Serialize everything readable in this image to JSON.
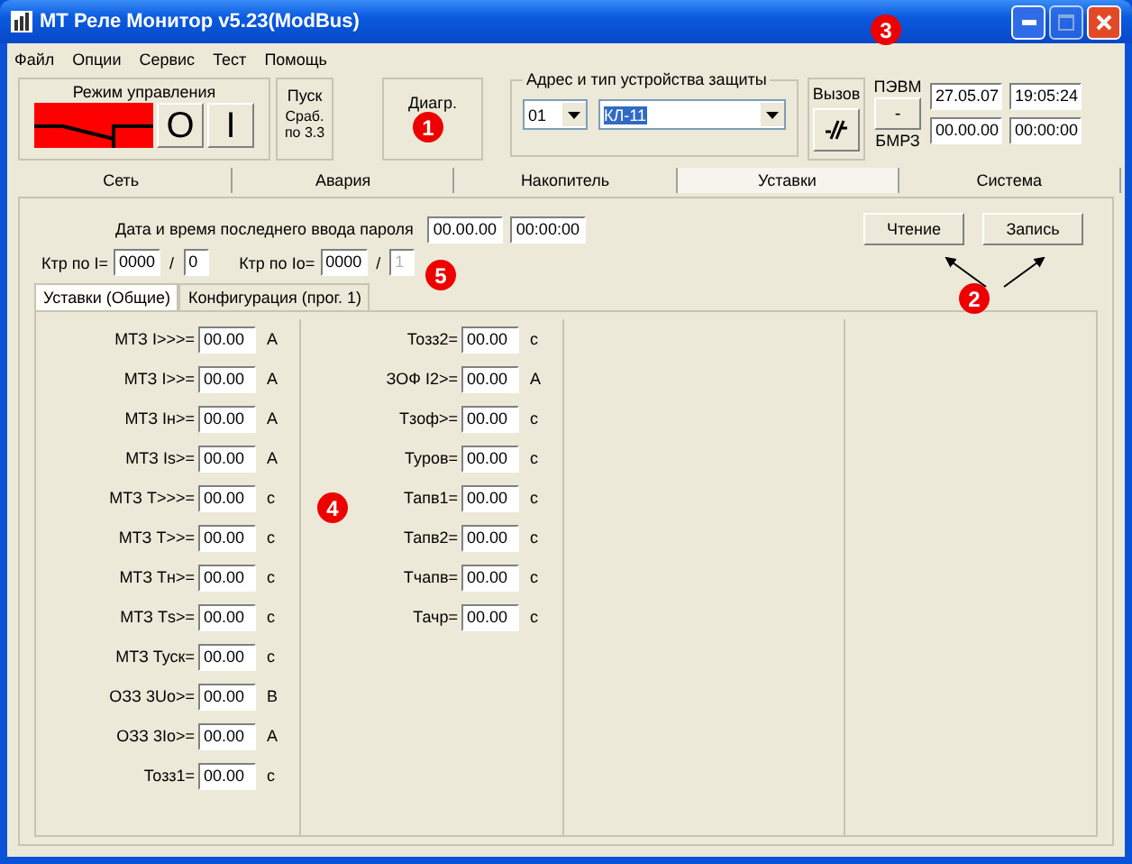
{
  "window": {
    "title": "МТ Реле Монитор v5.23(ModBus)"
  },
  "menu": [
    "Файл",
    "Опции",
    "Сервис",
    "Тест",
    "Помощь"
  ],
  "control_mode": {
    "label": "Режим управления",
    "buttons": [
      "O",
      "I"
    ]
  },
  "start": {
    "label": "Пуск",
    "status": "Сраб. по 3.3"
  },
  "diagram": {
    "label": "Диагр."
  },
  "device": {
    "label": "Адрес и тип устройства защиты",
    "address": "01",
    "type": "КЛ-11",
    "type_selected": true
  },
  "call": {
    "label": "Вызов"
  },
  "link": {
    "top": "ПЭВМ",
    "button": "-",
    "bottom": "БМРЗ"
  },
  "clock": [
    "27.05.07",
    "19:05:24",
    "00.00.00",
    "00:00:00"
  ],
  "tabs": [
    {
      "label": "Сеть",
      "selected": false
    },
    {
      "label": "Авария",
      "selected": false
    },
    {
      "label": "Накопитель",
      "selected": false
    },
    {
      "label": "Уставки",
      "selected": true
    },
    {
      "label": "Система",
      "selected": false
    }
  ],
  "password": {
    "label": "Дата и время последнего ввода пароля",
    "date": "00.00.00",
    "time": "00:00:00"
  },
  "actions": [
    "Чтение",
    "Запись"
  ],
  "ktr": [
    {
      "label": "Ктр по I=",
      "value": "0000",
      "sep": "/",
      "value2": "0",
      "disabled": false
    },
    {
      "label": "Ктр по Io=",
      "value": "0000",
      "sep": "/",
      "value2": "1",
      "disabled": true
    }
  ],
  "subtabs": [
    {
      "label": "Уставки (Общие)",
      "selected": true
    },
    {
      "label": "Конфигурация (прог. 1)",
      "selected": false
    }
  ],
  "columns": [
    [
      {
        "label": "МТЗ I>>>=",
        "value": "00.00",
        "unit": "А"
      },
      {
        "label": "МТЗ I>>=",
        "value": "00.00",
        "unit": "А"
      },
      {
        "label": "МТЗ Iн>=",
        "value": "00.00",
        "unit": "А"
      },
      {
        "label": "МТЗ Is>=",
        "value": "00.00",
        "unit": "А"
      },
      {
        "label": "МТЗ Т>>>=",
        "value": "00.00",
        "unit": "с"
      },
      {
        "label": "МТЗ Т>>=",
        "value": "00.00",
        "unit": "с"
      },
      {
        "label": "МТЗ Тн>=",
        "value": "00.00",
        "unit": "с"
      },
      {
        "label": "МТЗ Тs>=",
        "value": "00.00",
        "unit": "с"
      },
      {
        "label": "МТЗ Туск=",
        "value": "00.00",
        "unit": "с"
      },
      {
        "label": "ОЗЗ 3Uo>=",
        "value": "00.00",
        "unit": "В"
      },
      {
        "label": "ОЗЗ 3Io>=",
        "value": "00.00",
        "unit": "А"
      },
      {
        "label": "Тозз1=",
        "value": "00.00",
        "unit": "с"
      }
    ],
    [
      {
        "label": "Тозз2=",
        "value": "00.00",
        "unit": "с"
      },
      {
        "label": "ЗОФ I2>=",
        "value": "00.00",
        "unit": "А"
      },
      {
        "label": "Тзоф>=",
        "value": "00.00",
        "unit": "с"
      },
      {
        "label": "Туров=",
        "value": "00.00",
        "unit": "с"
      },
      {
        "label": "Тапв1=",
        "value": "00.00",
        "unit": "с"
      },
      {
        "label": "Тапв2=",
        "value": "00.00",
        "unit": "с"
      },
      {
        "label": "Тчапв=",
        "value": "00.00",
        "unit": "с"
      },
      {
        "label": "Тачр=",
        "value": "00.00",
        "unit": "с"
      }
    ]
  ],
  "callouts": [
    "1",
    "2",
    "3",
    "4",
    "5"
  ]
}
